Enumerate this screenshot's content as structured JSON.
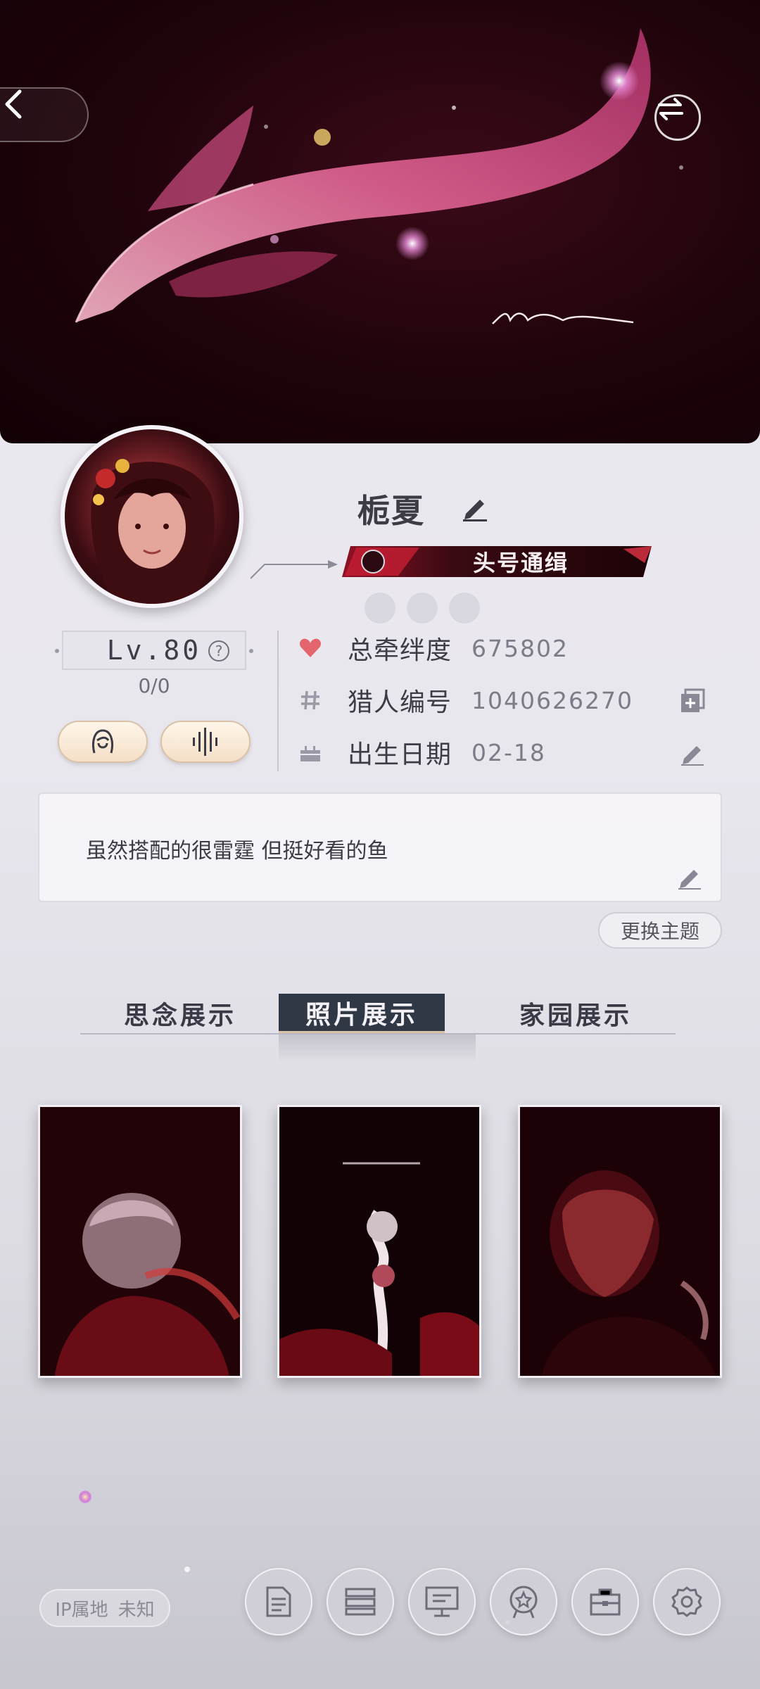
{
  "banner": {
    "signature_text": "Malume",
    "back_icon": "chevron-left-icon",
    "switch_icon": "swap-arrows-icon"
  },
  "profile": {
    "name": "栀夏",
    "title_badge": "头号通缉",
    "level": "Lv.80",
    "level_help": "?",
    "exp": "0/0"
  },
  "info": {
    "bond": {
      "label": "总牵绊度",
      "value": "675802",
      "icon": "heart-icon"
    },
    "hunter_id": {
      "label": "猎人编号",
      "value": "1040626270",
      "icon": "hash-icon"
    },
    "birthday": {
      "label": "出生日期",
      "value": "02-18",
      "icon": "cake-icon"
    }
  },
  "signature": {
    "text": "虽然搭配的很雷霆 但挺好看的鱼"
  },
  "theme_button": "更换主题",
  "tabs": [
    {
      "label": "思念展示",
      "active": false
    },
    {
      "label": "照片展示",
      "active": true
    },
    {
      "label": "家园展示",
      "active": false
    }
  ],
  "ip": {
    "label": "IP属地",
    "value": "未知"
  },
  "bottom_nav": [
    "document-icon",
    "cards-icon",
    "monitor-icon",
    "badge-icon",
    "briefcase-icon",
    "settings-icon"
  ],
  "colors": {
    "accent": "#2f3844",
    "heart": "#e4656d",
    "banner_bg": "#1e030a"
  }
}
